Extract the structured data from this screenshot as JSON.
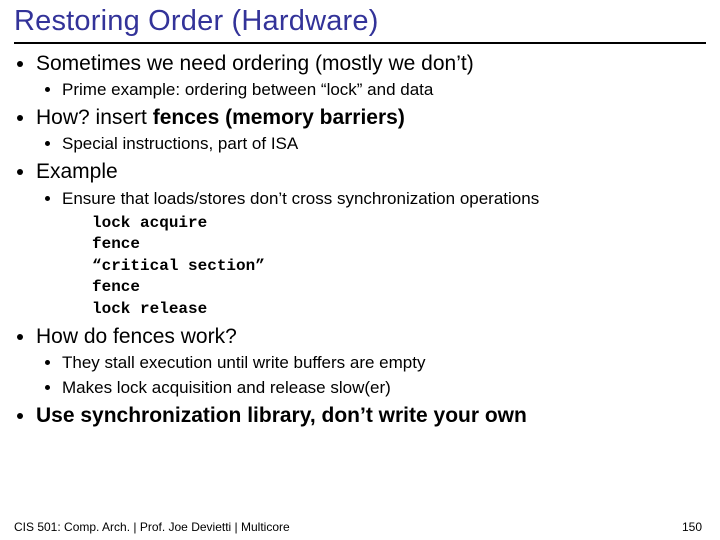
{
  "title": "Restoring Order (Hardware)",
  "bullets": {
    "b1": "Sometimes we need ordering (mostly we don’t)",
    "b1a": "Prime example: ordering between “lock” and data",
    "b2_pre": "How?  insert ",
    "b2_bold": "fences (memory barriers)",
    "b2a": "Special instructions, part of ISA",
    "b3": "Example",
    "b3a": "Ensure that loads/stores don’t cross synchronization operations",
    "code": {
      "l1": "lock acquire",
      "l2": "fence",
      "l3": "“critical section”",
      "l4": "fence",
      "l5": "lock release"
    },
    "b4": "How do fences work?",
    "b4a": "They stall execution until write buffers are empty",
    "b4b": "Makes lock acquisition and release slow(er)",
    "b5": "Use synchronization library, don’t write your own"
  },
  "footer": "CIS 501: Comp. Arch.  |  Prof. Joe Devietti  |  Multicore",
  "page_number": "150"
}
